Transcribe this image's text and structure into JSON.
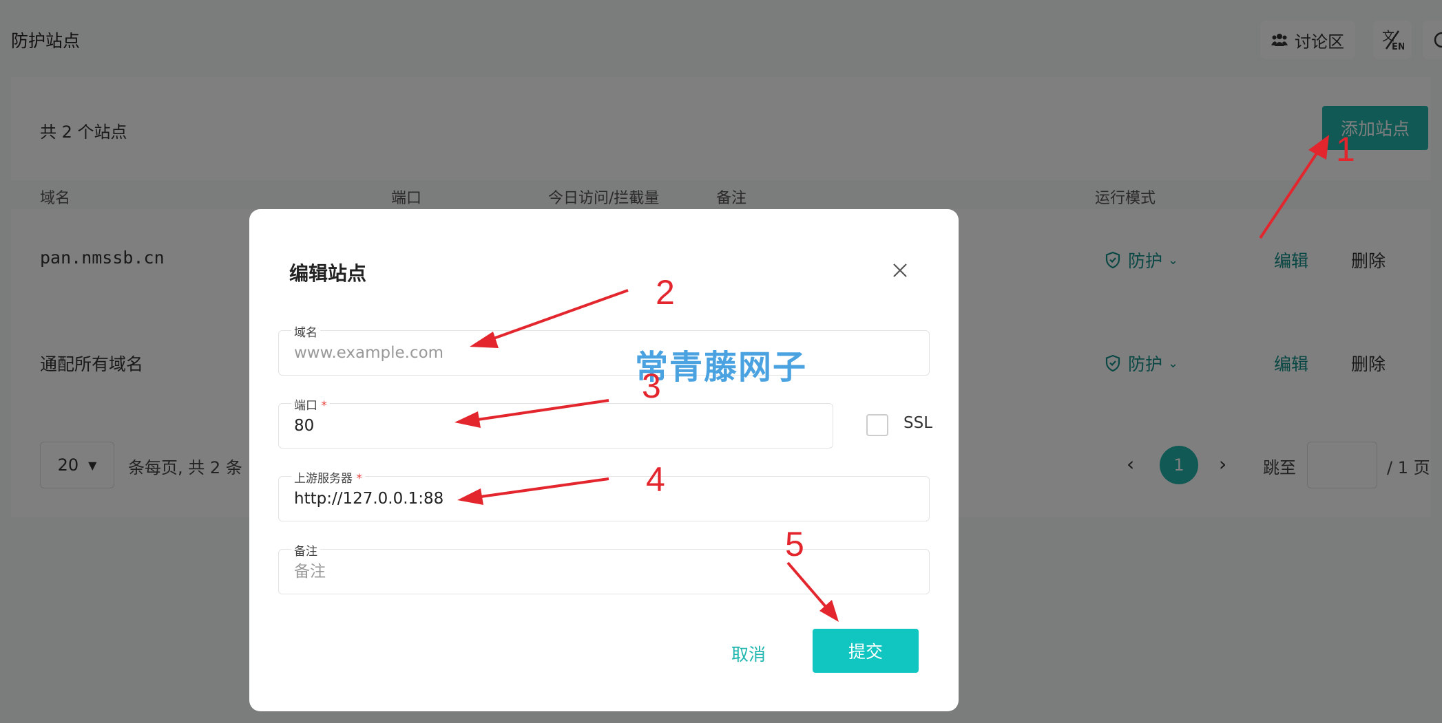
{
  "header": {
    "title": "防护站点",
    "forum_label": "讨论区"
  },
  "site_list": {
    "count_text": "共 2 个站点",
    "add_button": "添加站点",
    "columns": [
      "域名",
      "端口",
      "今日访问/拦截量",
      "备注",
      "运行模式"
    ],
    "rows": [
      {
        "domain": "pan.nmssb.cn",
        "mode": "防护",
        "edit": "编辑",
        "delete": "删除"
      },
      {
        "domain": "通配所有域名",
        "mode": "防护",
        "edit": "编辑",
        "delete": "删除"
      }
    ]
  },
  "pagination": {
    "page_size": "20",
    "summary": "条每页, 共 2 条",
    "current_page": "1",
    "jump_label": "跳至",
    "total_pages": "/ 1 页"
  },
  "dialog": {
    "title": "编辑站点",
    "domain": {
      "label": "域名",
      "placeholder": "www.example.com",
      "value": ""
    },
    "port": {
      "label": "端口",
      "required_mark": "*",
      "value": "80"
    },
    "ssl_label": "SSL",
    "ssl_checked": false,
    "upstream": {
      "label": "上游服务器",
      "required_mark": "*",
      "value": "http://127.0.0.1:88"
    },
    "remark": {
      "label": "备注",
      "placeholder": "备注",
      "value": ""
    },
    "cancel_button": "取消",
    "submit_button": "提交"
  },
  "watermark": "常青藤网子",
  "annotations": [
    "1",
    "2",
    "3",
    "4",
    "5"
  ],
  "colors": {
    "accent": "#20b2aa",
    "submit": "#11c6c0",
    "annotation": "#e3262d",
    "watermark": "#4aa3e0"
  },
  "icons": [
    "users-icon",
    "translate-icon",
    "shield-check-icon",
    "chevron-down-icon",
    "close-icon",
    "chevron-left-icon",
    "chevron-right-icon"
  ]
}
